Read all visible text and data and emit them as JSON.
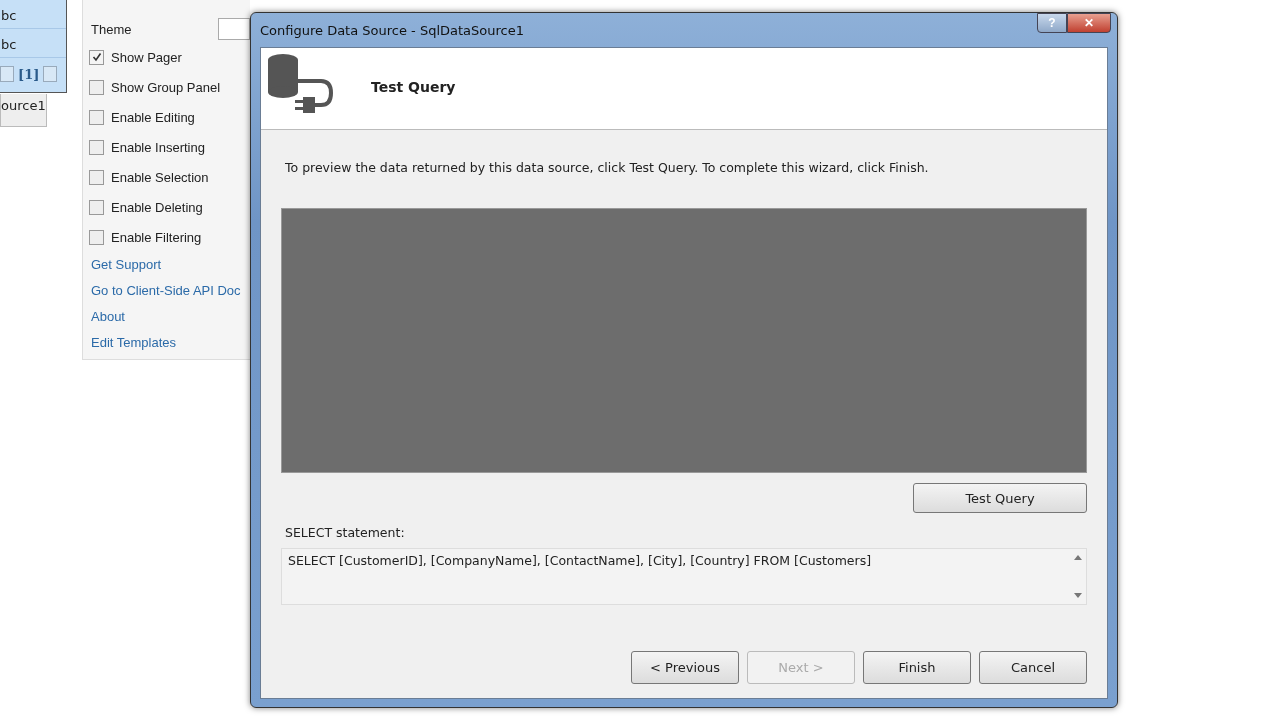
{
  "designer": {
    "grid_cells": [
      "bc",
      "bc"
    ],
    "pager": {
      "page": "[1]"
    },
    "datasource_label": "ource1"
  },
  "smart_tag": {
    "theme_label": "Theme",
    "options": [
      {
        "label": "Show Pager",
        "checked": true
      },
      {
        "label": "Show Group Panel",
        "checked": false
      },
      {
        "label": "Enable Editing",
        "checked": false
      },
      {
        "label": "Enable Inserting",
        "checked": false
      },
      {
        "label": "Enable Selection",
        "checked": false
      },
      {
        "label": "Enable Deleting",
        "checked": false
      },
      {
        "label": "Enable Filtering",
        "checked": false
      }
    ],
    "links": [
      "Get Support",
      "Go to Client-Side API Doc",
      "About",
      "Edit Templates"
    ]
  },
  "window": {
    "title": "Configure Data Source - SqlDataSource1",
    "help": "?",
    "close": "✕"
  },
  "header": {
    "title": "Test Query"
  },
  "description": "To preview the data returned by this data source, click Test Query. To complete this wizard, click Finish.",
  "test_button": "Test Query",
  "select_label": "SELECT statement:",
  "select_statement": "SELECT [CustomerID], [CompanyName], [ContactName], [City], [Country] FROM [Customers]",
  "buttons": [
    {
      "label": "< Previous",
      "disabled": false
    },
    {
      "label": "Next >",
      "disabled": true
    },
    {
      "label": "Finish",
      "disabled": false
    },
    {
      "label": "Cancel",
      "disabled": false
    }
  ]
}
